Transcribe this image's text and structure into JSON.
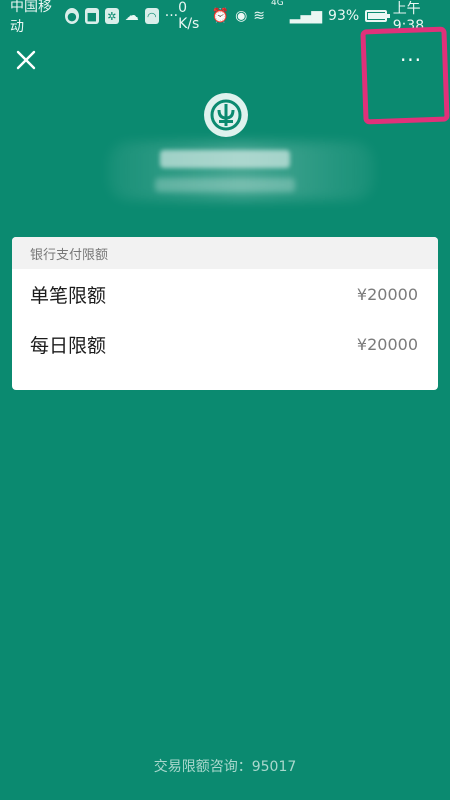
{
  "status_bar": {
    "carrier": "中国移动",
    "network_speed": "0 K/s",
    "signal_label": "4G",
    "battery_percent": "93%",
    "time": "上午9:38",
    "overflow": "···",
    "battery_level": 0.93
  },
  "top_bar": {
    "more_label": "···"
  },
  "card": {
    "header": "银行支付限额",
    "rows": [
      {
        "label": "单笔限额",
        "value": "¥20000"
      },
      {
        "label": "每日限额",
        "value": "¥20000"
      }
    ]
  },
  "footer": {
    "text": "交易限额咨询：95017"
  },
  "colors": {
    "background": "#0b8a70",
    "annotation": "#e0317a"
  }
}
